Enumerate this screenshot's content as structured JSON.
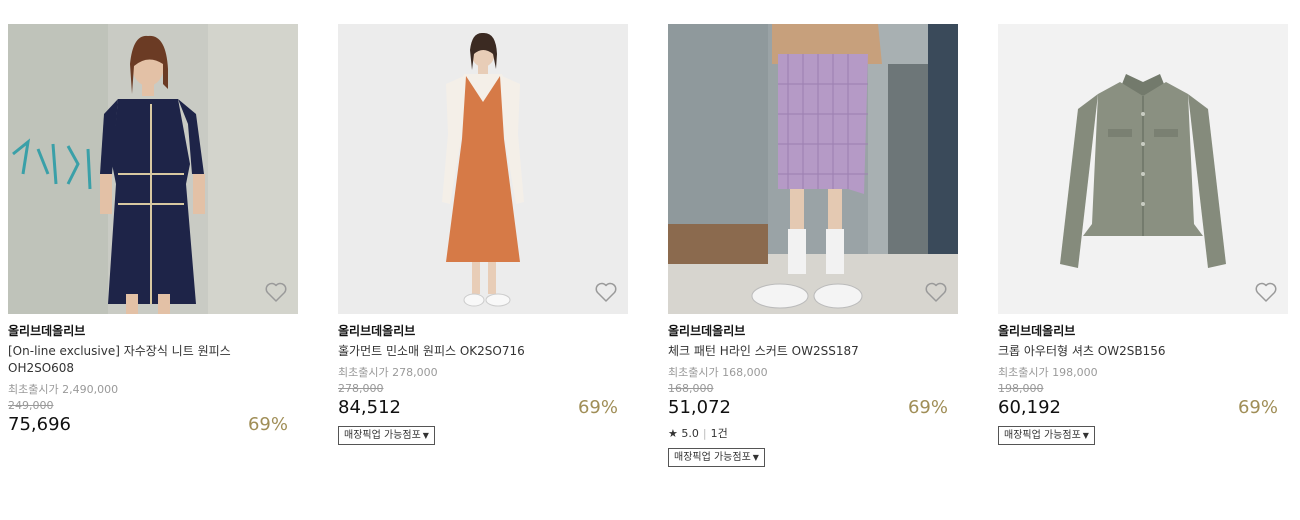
{
  "products": [
    {
      "brand": "올리브데올리브",
      "name": "[On-line exclusive] 자수장식 니트 원피스 OH2SO608",
      "orig_label": "최초출시가 2,490,000",
      "strike_price": "249,000",
      "price": "75,696",
      "discount": "69%"
    },
    {
      "brand": "올리브데올리브",
      "name": "홀가먼트 민소매 원피스 OK2SO716",
      "orig_label": "최초출시가 278,000",
      "strike_price": "278,000",
      "price": "84,512",
      "discount": "69%",
      "pickup": "매장픽업 가능점포"
    },
    {
      "brand": "올리브데올리브",
      "name": "체크 패턴 H라인 스커트 OW2SS187",
      "orig_label": "최초출시가 168,000",
      "strike_price": "168,000",
      "price": "51,072",
      "discount": "69%",
      "rating": "5.0",
      "reviews": "1건",
      "pickup": "매장픽업 가능점포"
    },
    {
      "brand": "올리브데올리브",
      "name": "크롭 아우터형 셔츠 OW2SB156",
      "orig_label": "최초출시가 198,000",
      "strike_price": "198,000",
      "price": "60,192",
      "discount": "69%",
      "pickup": "매장픽업 가능점포"
    }
  ],
  "icons": {
    "wishlist": "heart-outline-icon",
    "star": "star-icon",
    "dropdown": "caret-down-icon"
  },
  "colors": {
    "discount": "#a08e57",
    "muted": "#9a9a9a"
  }
}
